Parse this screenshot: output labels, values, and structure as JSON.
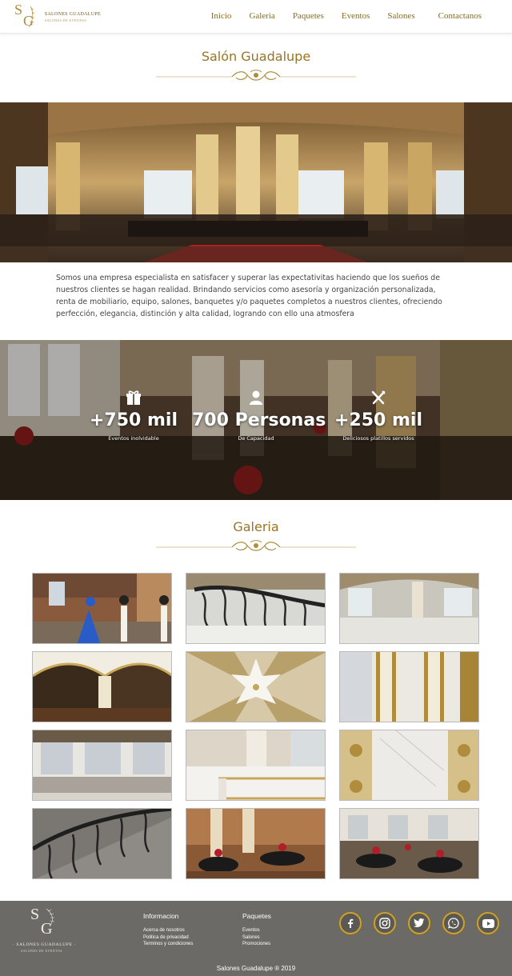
{
  "nav": {
    "logo": {
      "initials_s": "S",
      "initials_g": "G",
      "name": "SALONES GUADALUPE",
      "subtitle": "SALONES DE EVENTOS"
    },
    "menu": [
      "Inicio",
      "Galeria",
      "Paquetes",
      "Eventos",
      "Salones",
      "Contactanos"
    ]
  },
  "about": {
    "title": "Salón Guadalupe",
    "text": "Somos una empresa especialista en satisfacer y superar las expectativitas haciendo que los  sueños de nuestros clientes se hagan  realidad. Brindando servicios como asesoría y organización personalizada, renta de mobiliario, equipo, salones, banquetes y/o  paquetes completos a nuestros clientes, ofreciendo perfección, elegancia, distinción y alta calidad, logrando  con ello  una  atmosfera"
  },
  "stats": [
    {
      "icon": "gift-icon",
      "value": "+750 mil",
      "label": "Eventos inolvidable"
    },
    {
      "icon": "person-icon",
      "value": "700 Personas",
      "label": "De Capacidad"
    },
    {
      "icon": "utensils-icon",
      "value": "+250 mil",
      "label": "Deliciosos platillos servidos"
    }
  ],
  "gallery": {
    "title": "Galeria",
    "count": 12
  },
  "footer": {
    "logo": {
      "initials_s": "S",
      "initials_g": "G",
      "name": "· SALONES GUADALUPE ·",
      "subtitle": "SALONES DE EVENTOS"
    },
    "info": {
      "heading": "Informacion",
      "links": [
        "Acerca de nosotros",
        "Politica de privacidad",
        "Terminos y condiciones"
      ]
    },
    "packages": {
      "heading": "Paquetes",
      "links": [
        "Eventos",
        "Salones",
        "Promociones"
      ]
    },
    "socials": [
      "facebook-icon",
      "instagram-icon",
      "twitter-icon",
      "whatsapp-icon",
      "youtube-icon"
    ],
    "copyright": "Salones Guadalupe ® 2019"
  },
  "colors": {
    "gold": "#9a7420",
    "footer_bg": "#6b6a66",
    "social_ring": "#c9a13a"
  }
}
